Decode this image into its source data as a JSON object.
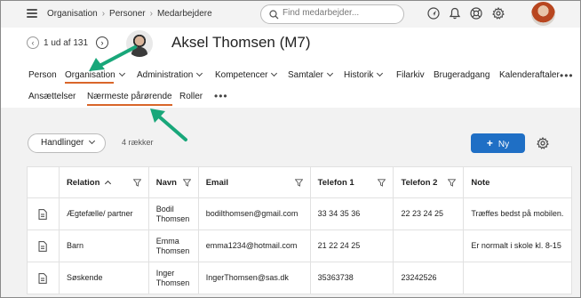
{
  "topbar": {
    "breadcrumbs": [
      "Organisation",
      "Personer",
      "Medarbejdere"
    ],
    "search_placeholder": "Find medarbejder...",
    "icons": [
      "navigate-icon",
      "bell-icon",
      "help-icon",
      "gear-icon"
    ]
  },
  "record": {
    "pager_text": "1 ud af 131",
    "name": "Aksel Thomsen (M7)"
  },
  "mainnav": {
    "items": [
      {
        "label": "Person",
        "caret": false
      },
      {
        "label": "Organisation",
        "caret": true
      },
      {
        "label": "Administration",
        "caret": true
      },
      {
        "label": "Kompetencer",
        "caret": true
      },
      {
        "label": "Samtaler",
        "caret": true
      },
      {
        "label": "Historik",
        "caret": true
      },
      {
        "label": "Filarkiv",
        "caret": false
      },
      {
        "label": "Brugeradgang",
        "caret": false
      },
      {
        "label": "Kalenderaftaler",
        "caret": false
      }
    ],
    "active": "Organisation",
    "more": "•••"
  },
  "subnav": {
    "items": [
      "Ansættelser",
      "Nærmeste pårørende",
      "Roller"
    ],
    "active": "Nærmeste pårørende",
    "more": "•••"
  },
  "toolbar": {
    "actions_label": "Handlinger",
    "row_count": "4 rækker",
    "new_label": "Ny"
  },
  "table": {
    "columns": [
      "",
      "Relation",
      "Navn",
      "Email",
      "Telefon 1",
      "Telefon 2",
      "Note"
    ],
    "rows": [
      {
        "relation": "Ægtefælle/ partner",
        "navn": "Bodil Thomsen",
        "email": "bodilthomsen@gmail.com",
        "tlf1": "33 34 35 36",
        "tlf2": "22 23 24 25",
        "note": "Træffes bedst på mobilen."
      },
      {
        "relation": "Barn",
        "navn": "Emma Thomsen",
        "email": "emma1234@hotmail.com",
        "tlf1": "21 22 24 25",
        "tlf2": "",
        "note": "Er normalt i skole kl. 8-15"
      },
      {
        "relation": "Søskende",
        "navn": "Inger Thomsen",
        "email": "IngerThomsen@sas.dk",
        "tlf1": "35363738",
        "tlf2": "23242526",
        "note": ""
      }
    ]
  },
  "colors": {
    "accent": "#d9662a",
    "primary": "#1f6fc5",
    "link": "#1f63b5",
    "annotation_arrow": "#19a77a"
  }
}
